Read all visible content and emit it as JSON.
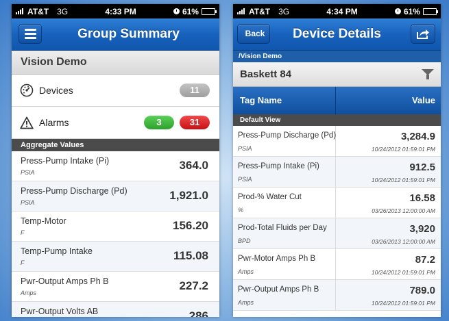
{
  "left": {
    "status": {
      "carrier": "AT&T",
      "network": "3G",
      "time": "4:33 PM",
      "battery": "61%",
      "battery_level": 0.61
    },
    "nav": {
      "title": "Group Summary"
    },
    "group": {
      "name": "Vision Demo"
    },
    "devices": {
      "label": "Devices",
      "count": "11"
    },
    "alarms": {
      "label": "Alarms",
      "green_count": "3",
      "red_count": "31"
    },
    "section": "Aggregate Values",
    "rows": [
      {
        "name": "Press-Pump Intake (Pi)",
        "unit": "PSIA",
        "value": "364.0"
      },
      {
        "name": "Press-Pump Discharge (Pd)",
        "unit": "PSIA",
        "value": "1,921.0"
      },
      {
        "name": "Temp-Motor",
        "unit": "F",
        "value": "156.20"
      },
      {
        "name": "Temp-Pump Intake",
        "unit": "F",
        "value": "115.08"
      },
      {
        "name": "Pwr-Output Amps Ph B",
        "unit": "Amps",
        "value": "227.2"
      },
      {
        "name": "Pwr-Output Volts AB",
        "unit": "",
        "value": "286"
      }
    ]
  },
  "right": {
    "status": {
      "carrier": "AT&T",
      "network": "3G",
      "time": "4:34 PM",
      "battery": "61%",
      "battery_level": 0.61
    },
    "nav": {
      "title": "Device Details",
      "back_label": "Back"
    },
    "crumb": "/Vision Demo",
    "device": {
      "name": "Baskett 84"
    },
    "columns": {
      "name": "Tag Name",
      "value": "Value"
    },
    "section": "Default View",
    "rows": [
      {
        "name": "Press-Pump Discharge (Pd)",
        "unit": "PSIA",
        "value": "3,284.9",
        "ts": "10/24/2012 01:59:01 PM"
      },
      {
        "name": "Press-Pump Intake (Pi)",
        "unit": "PSIA",
        "value": "912.5",
        "ts": "10/24/2012 01:59:01 PM"
      },
      {
        "name": "Prod-% Water Cut",
        "unit": "%",
        "value": "16.58",
        "ts": "03/26/2013 12:00:00 AM"
      },
      {
        "name": "Prod-Total Fluids per Day",
        "unit": "BPD",
        "value": "3,920",
        "ts": "03/26/2013 12:00:00 AM"
      },
      {
        "name": "Pwr-Motor Amps Ph B",
        "unit": "Amps",
        "value": "87.2",
        "ts": "10/24/2012 01:59:01 PM"
      },
      {
        "name": "Pwr-Output Amps Ph B",
        "unit": "Amps",
        "value": "789.0",
        "ts": "10/24/2012 01:59:01 PM"
      }
    ]
  }
}
